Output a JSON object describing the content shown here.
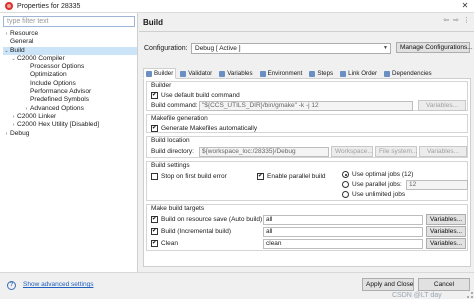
{
  "window": {
    "title": "Properties for 28335",
    "close_glyph": "✕"
  },
  "filter": {
    "placeholder": "type filter text"
  },
  "tree": [
    {
      "label": "Resource",
      "level": 0,
      "twisty": "›"
    },
    {
      "label": "General",
      "level": 0,
      "twisty": ""
    },
    {
      "label": "Build",
      "level": 0,
      "twisty": "⌄",
      "selected": true
    },
    {
      "label": "C2000 Compiler",
      "level": 1,
      "twisty": "⌄"
    },
    {
      "label": "Processor Options",
      "level": 2,
      "twisty": ""
    },
    {
      "label": "Optimization",
      "level": 2,
      "twisty": ""
    },
    {
      "label": "Include Options",
      "level": 2,
      "twisty": ""
    },
    {
      "label": "Performance Advisor",
      "level": 2,
      "twisty": ""
    },
    {
      "label": "Predefined Symbols",
      "level": 2,
      "twisty": ""
    },
    {
      "label": "Advanced Options",
      "level": 2,
      "twisty": "›"
    },
    {
      "label": "C2000 Linker",
      "level": 1,
      "twisty": "›"
    },
    {
      "label": "C2000 Hex Utility  [Disabled]",
      "level": 1,
      "twisty": "›"
    },
    {
      "label": "Debug",
      "level": 0,
      "twisty": "›"
    }
  ],
  "header": {
    "title": "Build",
    "back_glyph": "⇦",
    "forward_glyph": "⇨",
    "menu_glyph": "⋮"
  },
  "configuration": {
    "label": "Configuration:",
    "value": "Debug  [ Active ]",
    "manage_button": "Manage Configurations..."
  },
  "tabs": [
    {
      "label": "Builder",
      "active": true
    },
    {
      "label": "Validator",
      "active": false
    },
    {
      "label": "Variables",
      "active": false
    },
    {
      "label": "Environment",
      "active": false
    },
    {
      "label": "Steps",
      "active": false
    },
    {
      "label": "Link Order",
      "active": false
    },
    {
      "label": "Dependencies",
      "active": false
    }
  ],
  "builder": {
    "title": "Builder",
    "use_default_label": "Use default build command",
    "build_command_label": "Build command:",
    "build_command_value": "\"${CCS_UTILS_DIR}/bin/gmake\" -k -j 12",
    "variables_label": "Variables..."
  },
  "makefile": {
    "title": "Makefile generation",
    "generate_label": "Generate Makefiles automatically"
  },
  "location": {
    "title": "Build location",
    "dir_label": "Build directory:",
    "dir_value": "${workspace_loc:/28335}/Debug",
    "workspace_btn": "Workspace...",
    "filesystem_btn": "File system...",
    "variables_btn": "Variables..."
  },
  "settings": {
    "title": "Build settings",
    "stop_label": "Stop on first build error",
    "parallel_label": "Enable parallel build",
    "optimal_label": "Use optimal jobs (12)",
    "parallel_jobs_label": "Use parallel jobs:",
    "parallel_jobs_value": "12",
    "unlimited_label": "Use unlimited jobs"
  },
  "targets": {
    "title": "Make build targets",
    "variables_label": "Variables...",
    "rows": [
      {
        "label": "Build on resource save (Auto build)",
        "value": "all"
      },
      {
        "label": "Build (Incremental build)",
        "value": "all"
      },
      {
        "label": "Clean",
        "value": "clean"
      }
    ]
  },
  "footer": {
    "help_glyph": "?",
    "advanced_link": "Show advanced settings",
    "apply_button": "Apply and Close",
    "cancel_button": "Cancel",
    "watermark": "CSDN @LT day"
  }
}
